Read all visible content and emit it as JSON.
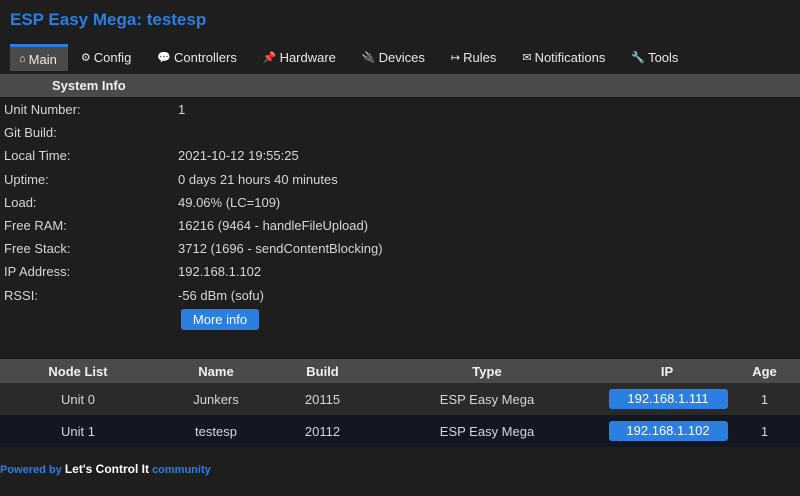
{
  "app": {
    "title": "ESP Easy Mega: testesp"
  },
  "tabs": [
    {
      "icon": "⌂",
      "label": "Main"
    },
    {
      "icon": "⚙",
      "label": "Config"
    },
    {
      "icon": "💬",
      "label": "Controllers"
    },
    {
      "icon": "📌",
      "label": "Hardware"
    },
    {
      "icon": "🔌",
      "label": "Devices"
    },
    {
      "icon": "↦",
      "label": "Rules"
    },
    {
      "icon": "✉",
      "label": "Notifications"
    },
    {
      "icon": "🔧",
      "label": "Tools"
    }
  ],
  "system_info": {
    "header": "System Info",
    "rows": [
      {
        "label": "Unit Number:",
        "value": "1"
      },
      {
        "label": "Git Build:",
        "value": ""
      },
      {
        "label": "Local Time:",
        "value": "2021-10-12 19:55:25"
      },
      {
        "label": "Uptime:",
        "value": "0 days 21 hours 40 minutes"
      },
      {
        "label": "Load:",
        "value": "49.06% (LC=109)"
      },
      {
        "label": "Free RAM:",
        "value": "16216 (9464 - handleFileUpload)"
      },
      {
        "label": "Free Stack:",
        "value": "3712 (1696 - sendContentBlocking)"
      },
      {
        "label": "IP Address:",
        "value": "192.168.1.102"
      },
      {
        "label": "RSSI:",
        "value": "-56 dBm (sofu)"
      }
    ],
    "more_info_label": "More info"
  },
  "node_list": {
    "headers": [
      "Node List",
      "Name",
      "Build",
      "Type",
      "IP",
      "Age"
    ],
    "rows": [
      {
        "unit": "Unit 0",
        "name": "Junkers",
        "build": "20115",
        "type": "ESP Easy Mega",
        "ip": "192.168.1.111",
        "age": "1"
      },
      {
        "unit": "Unit 1",
        "name": "testesp",
        "build": "20112",
        "type": "ESP Easy Mega",
        "ip": "192.168.1.102",
        "age": "1"
      }
    ]
  },
  "footer": {
    "powered_by": "Powered by",
    "brand": "Let's Control It",
    "community": "community"
  },
  "colors": {
    "accent": "#2a7fe0",
    "background": "#1e1e1e",
    "header_bar": "#4a4a4a"
  }
}
